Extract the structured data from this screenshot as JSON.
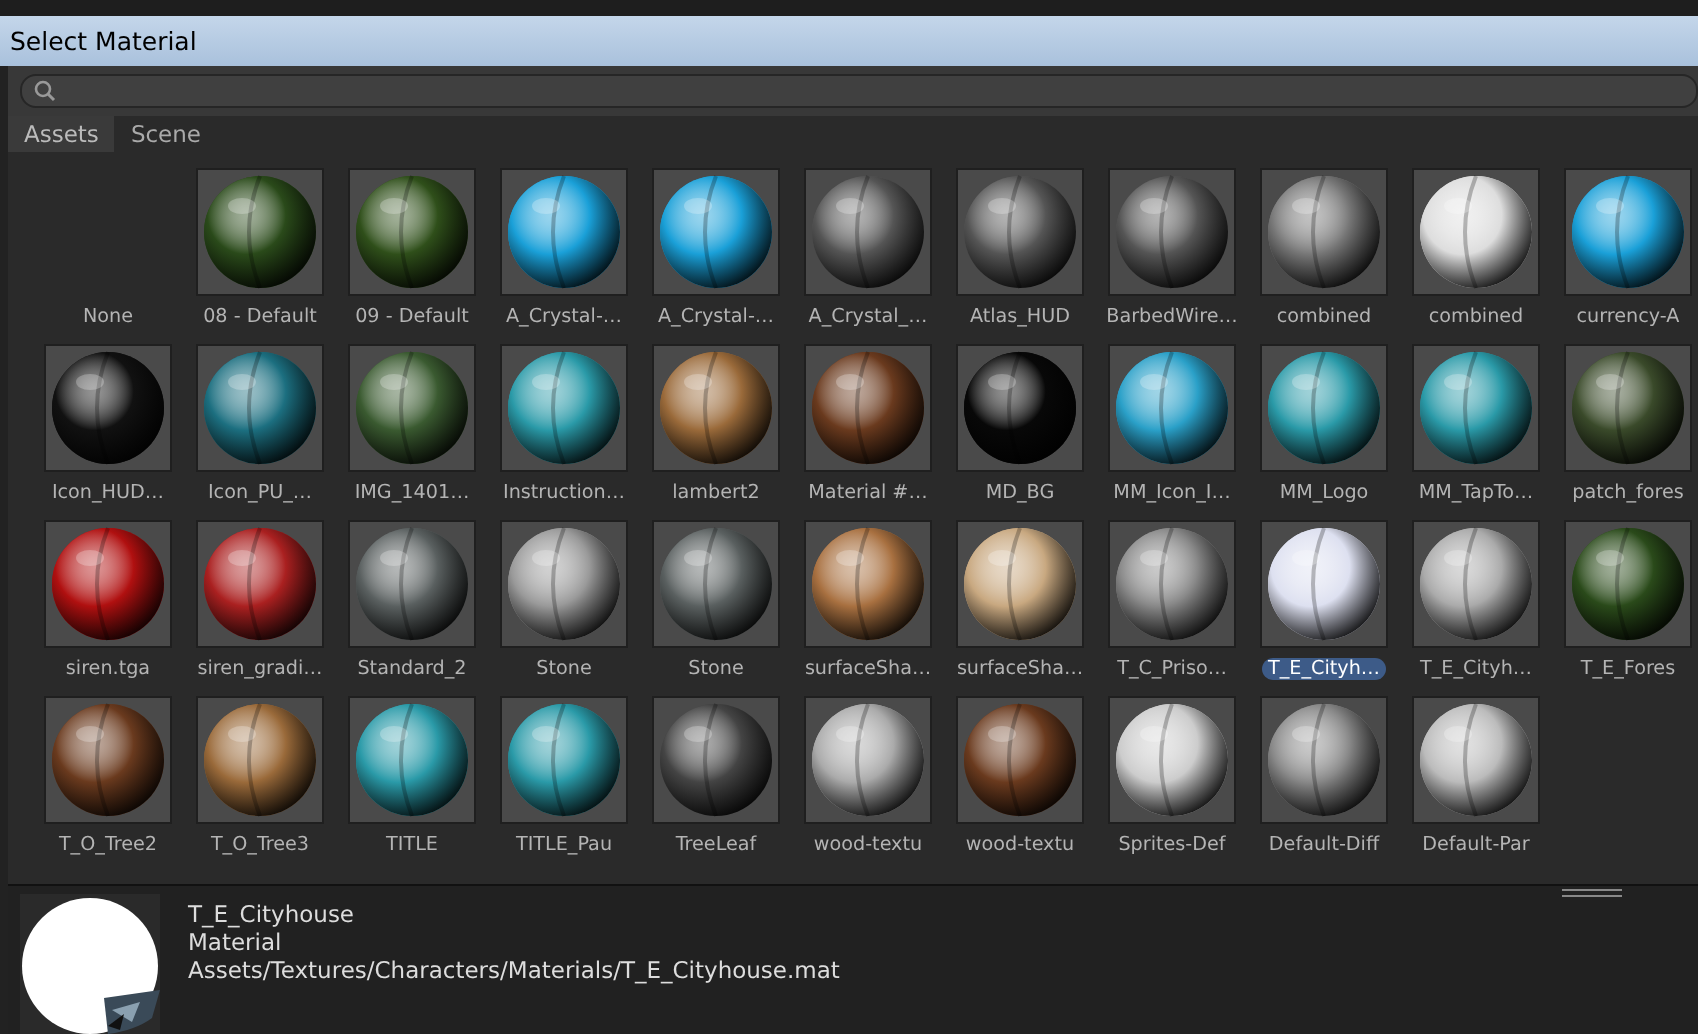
{
  "window": {
    "title": "Select Material"
  },
  "tabs": [
    {
      "label": "Assets",
      "selected": true
    },
    {
      "label": "Scene",
      "selected": false
    }
  ],
  "items": [
    {
      "label": "None",
      "kind": "none",
      "selected": false
    },
    {
      "label": "08 - Default",
      "kind": "material",
      "selected": false
    },
    {
      "label": "09 - Default",
      "kind": "material",
      "selected": false
    },
    {
      "label": "A_Crystal-…",
      "kind": "material",
      "selected": false
    },
    {
      "label": "A_Crystal-…",
      "kind": "material",
      "selected": false
    },
    {
      "label": "A_Crystal_…",
      "kind": "material",
      "selected": false
    },
    {
      "label": "Atlas_HUD",
      "kind": "material",
      "selected": false
    },
    {
      "label": "BarbedWire…",
      "kind": "material",
      "selected": false
    },
    {
      "label": "combined",
      "kind": "material",
      "selected": false
    },
    {
      "label": "combined",
      "kind": "material",
      "selected": false
    },
    {
      "label": "currency-A",
      "kind": "material",
      "selected": false
    },
    {
      "label": "Icon_HUD…",
      "kind": "material",
      "selected": false
    },
    {
      "label": "Icon_PU_…",
      "kind": "material",
      "selected": false
    },
    {
      "label": "IMG_1401…",
      "kind": "material",
      "selected": false
    },
    {
      "label": "Instruction…",
      "kind": "material",
      "selected": false
    },
    {
      "label": "lambert2",
      "kind": "material",
      "selected": false
    },
    {
      "label": "Material #…",
      "kind": "material",
      "selected": false
    },
    {
      "label": "MD_BG",
      "kind": "material",
      "selected": false
    },
    {
      "label": "MM_Icon_I…",
      "kind": "material",
      "selected": false
    },
    {
      "label": "MM_Logo",
      "kind": "material",
      "selected": false
    },
    {
      "label": "MM_TapTo…",
      "kind": "material",
      "selected": false
    },
    {
      "label": "patch_fores",
      "kind": "material",
      "selected": false
    },
    {
      "label": "siren.tga",
      "kind": "material",
      "selected": false
    },
    {
      "label": "siren_gradi…",
      "kind": "material",
      "selected": false
    },
    {
      "label": "Standard_2",
      "kind": "material",
      "selected": false
    },
    {
      "label": "Stone",
      "kind": "material",
      "selected": false
    },
    {
      "label": "Stone",
      "kind": "material",
      "selected": false
    },
    {
      "label": "surfaceSha…",
      "kind": "material",
      "selected": false
    },
    {
      "label": "surfaceSha…",
      "kind": "material",
      "selected": false
    },
    {
      "label": "T_C_Priso…",
      "kind": "material",
      "selected": false
    },
    {
      "label": "T_E_Cityh…",
      "kind": "material",
      "selected": true
    },
    {
      "label": "T_E_Cityh…",
      "kind": "material",
      "selected": false
    },
    {
      "label": "T_E_Fores",
      "kind": "material",
      "selected": false
    },
    {
      "label": "T_O_Tree2",
      "kind": "material",
      "selected": false
    },
    {
      "label": "T_O_Tree3",
      "kind": "material",
      "selected": false
    },
    {
      "label": "TITLE",
      "kind": "material",
      "selected": false
    },
    {
      "label": "TITLE_Pau",
      "kind": "material",
      "selected": false
    },
    {
      "label": "TreeLeaf",
      "kind": "material",
      "selected": false
    },
    {
      "label": "wood-textu",
      "kind": "material",
      "selected": false
    },
    {
      "label": "wood-textu",
      "kind": "material",
      "selected": false
    },
    {
      "label": "Sprites-Def",
      "kind": "material",
      "selected": false
    },
    {
      "label": "Default-Diff",
      "kind": "material",
      "selected": false
    },
    {
      "label": "Default-Par",
      "kind": "material",
      "selected": false
    }
  ],
  "preview": {
    "name": "T_E_Cityhouse",
    "type": "Material",
    "path": "Assets/Textures/Characters/Materials/T_E_Cityhouse.mat"
  }
}
